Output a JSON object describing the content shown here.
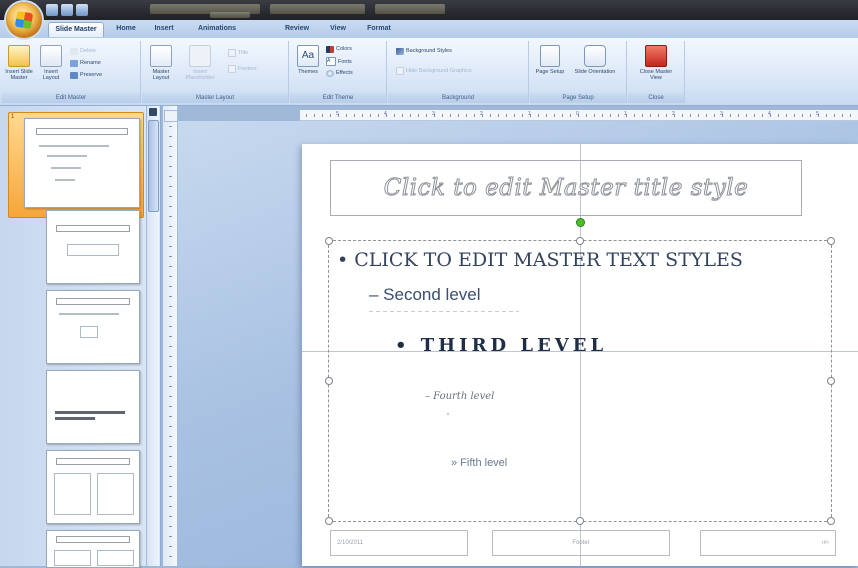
{
  "ribbon": {
    "tabs": [
      "Slide Master",
      "Home",
      "Insert",
      "Animations",
      "Review",
      "View",
      "Format"
    ],
    "active_tab": "Slide Master",
    "groups": {
      "edit_master": {
        "label": "Edit Master",
        "insert_slide_master": "Insert Slide Master",
        "insert_layout": "Insert Layout",
        "delete": "Delete",
        "rename": "Rename",
        "preserve": "Preserve"
      },
      "master_layout": {
        "label": "Master Layout",
        "master_layout": "Master Layout",
        "insert_placeholder": "Insert Placeholder",
        "title": "Title",
        "footers": "Footers"
      },
      "edit_theme": {
        "label": "Edit Theme",
        "themes": "Themes",
        "colors": "Colors",
        "fonts": "Fonts",
        "effects": "Effects"
      },
      "background": {
        "label": "Background",
        "background_styles": "Background Styles",
        "hide_background_graphics": "Hide Background Graphics"
      },
      "page_setup": {
        "label": "Page Setup",
        "page_setup": "Page Setup",
        "slide_orientation": "Slide Orientation"
      },
      "close": {
        "label": "Close",
        "close_master_view": "Close Master View"
      }
    }
  },
  "thumbnails": {
    "selected_number": "1",
    "count": 6
  },
  "ruler": {
    "numbers": [
      "5",
      "4",
      "3",
      "2",
      "1",
      "0",
      "1",
      "2",
      "3",
      "4",
      "5"
    ]
  },
  "slide": {
    "title_placeholder": "Click to edit Master title style",
    "level1": "• CLICK TO EDIT MASTER TEXT STYLES",
    "level2": "– Second level",
    "level3": "• THIRD LEVEL",
    "level4": "– Fourth level",
    "level5": "» Fifth level",
    "footer_date": "2/10/2011",
    "footer_text": "Footer",
    "footer_number": "‹#›"
  },
  "colors": {
    "accent_orange": "#f5a63a",
    "ribbon_blue": "#c8daf1",
    "rotate_handle_green": "#4cc02a"
  },
  "icons": [
    "office-button-icon",
    "save-icon",
    "undo-icon",
    "redo-icon",
    "themes-icon",
    "colors-icon",
    "fonts-icon",
    "effects-icon",
    "close-master-view-icon"
  ]
}
